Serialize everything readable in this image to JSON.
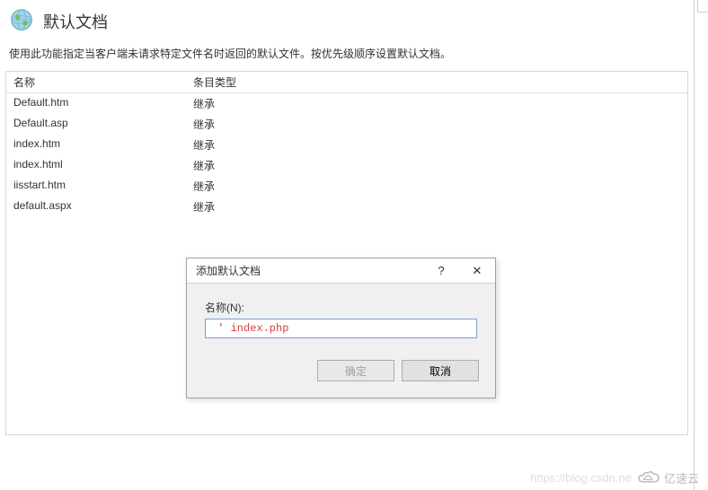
{
  "header": {
    "title": "默认文档"
  },
  "description": "使用此功能指定当客户端未请求特定文件名时返回的默认文件。按优先级顺序设置默认文档。",
  "table": {
    "columns": {
      "name": "名称",
      "type": "条目类型"
    },
    "rows": [
      {
        "name": "Default.htm",
        "type": "继承"
      },
      {
        "name": "Default.asp",
        "type": "继承"
      },
      {
        "name": "index.htm",
        "type": "继承"
      },
      {
        "name": "index.html",
        "type": "继承"
      },
      {
        "name": "iisstart.htm",
        "type": "继承"
      },
      {
        "name": "default.aspx",
        "type": "继承"
      }
    ]
  },
  "dialog": {
    "title": "添加默认文档",
    "help": "?",
    "close": "✕",
    "name_label": "名称(N):",
    "name_value": " ' index.php",
    "ok": "确定",
    "cancel": "取消"
  },
  "watermark": {
    "url": "https://blog.csdn.ne",
    "brand": "亿速云"
  }
}
